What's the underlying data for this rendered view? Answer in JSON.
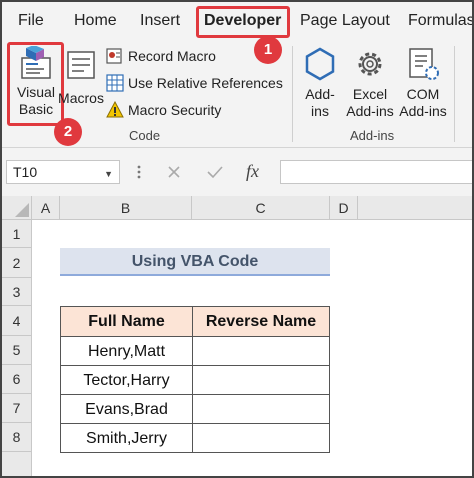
{
  "tabs": {
    "file": "File",
    "home": "Home",
    "insert": "Insert",
    "developer": "Developer",
    "page_layout": "Page Layout",
    "formulas": "Formulas"
  },
  "ribbon": {
    "visual_basic": {
      "line1": "Visual",
      "line2": "Basic"
    },
    "macros": "Macros",
    "record_macro": "Record Macro",
    "use_relative_references": "Use Relative References",
    "macro_security": "Macro Security",
    "code_group": "Code",
    "add_ins": {
      "line1": "Add-",
      "line2": "ins"
    },
    "excel_add_ins": {
      "line1": "Excel",
      "line2": "Add-ins"
    },
    "com_add_ins": {
      "line1": "COM",
      "line2": "Add-ins"
    },
    "add_ins_group": "Add-ins"
  },
  "annotations": {
    "step1": "1",
    "step2": "2"
  },
  "formula_bar": {
    "name_box": "T10",
    "fx_symbol": "fx",
    "formula": ""
  },
  "grid": {
    "columns": [
      "A",
      "B",
      "C",
      "D"
    ],
    "rows": [
      "1",
      "2",
      "3",
      "4",
      "5",
      "6",
      "7",
      "8"
    ],
    "title": "Using VBA Code",
    "table": {
      "headers": [
        "Full Name",
        "Reverse Name"
      ],
      "rows": [
        [
          "Henry,Matt",
          ""
        ],
        [
          "Tector,Harry",
          ""
        ],
        [
          "Evans,Brad",
          ""
        ],
        [
          "Smith,Jerry",
          ""
        ]
      ]
    }
  },
  "colors": {
    "highlight_red": "#e0393e",
    "header_fill": "#fce4d6",
    "title_fill": "#dde3ee",
    "title_text": "#44546a",
    "icon_blue": "#2f6db5"
  }
}
